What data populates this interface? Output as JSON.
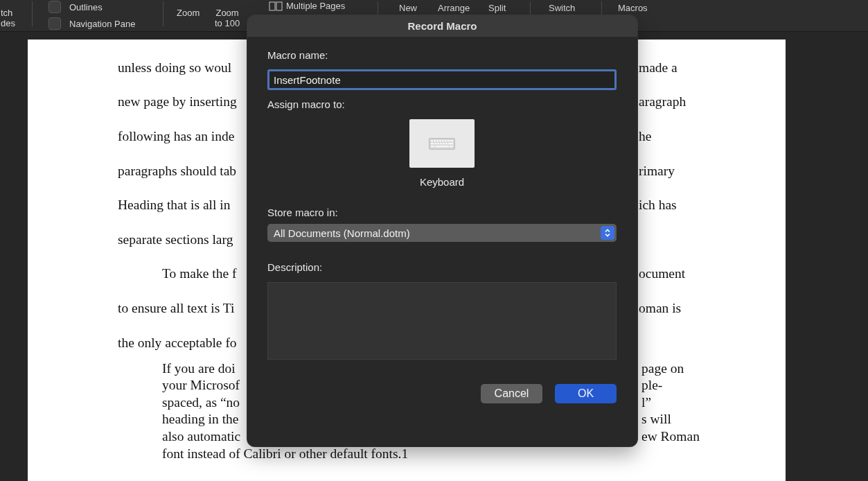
{
  "toolbar": {
    "items": [
      {
        "kind": "label",
        "lines": [
          "tch",
          "des"
        ]
      },
      {
        "kind": "divider"
      },
      {
        "kind": "checks",
        "boxes": [
          {
            "label": "Outlines",
            "checked": false
          },
          {
            "label": "Navigation Pane",
            "checked": false
          }
        ]
      },
      {
        "kind": "divider"
      },
      {
        "kind": "label",
        "lines": [
          "Zoom"
        ]
      },
      {
        "kind": "label",
        "lines": [
          "Zoom",
          "to 100"
        ]
      },
      {
        "kind": "pages",
        "lines": [
          "Multiple Pages"
        ]
      },
      {
        "kind": "divider"
      },
      {
        "kind": "label",
        "lines": [
          "New"
        ]
      },
      {
        "kind": "label",
        "lines": [
          "Arrange"
        ]
      },
      {
        "kind": "label",
        "lines": [
          "Split"
        ]
      },
      {
        "kind": "divider"
      },
      {
        "kind": "label",
        "lines": [
          "Switch"
        ]
      },
      {
        "kind": "divider"
      },
      {
        "kind": "label",
        "lines": [
          "Macros"
        ]
      }
    ]
  },
  "document": {
    "lines": [
      {
        "kind": "double",
        "indent": false,
        "left": "unless doing so woul",
        "right": "made a"
      },
      {
        "kind": "double",
        "indent": false,
        "left": "new page by inserting",
        "right": "aragraph"
      },
      {
        "kind": "double",
        "indent": false,
        "left": "following has an inde",
        "right": "he"
      },
      {
        "kind": "double",
        "indent": false,
        "left": "paragraphs should tab",
        "right": "rimary"
      },
      {
        "kind": "double",
        "indent": false,
        "left": "Heading that is all in",
        "right": "ich has"
      },
      {
        "kind": "double",
        "indent": false,
        "left": "separate sections larg"
      },
      {
        "kind": "double",
        "indent": true,
        "left": "To make the f",
        "right": "ocument"
      },
      {
        "kind": "double",
        "indent": false,
        "left": "to ensure all text is Ti",
        "right": "oman is"
      },
      {
        "kind": "double",
        "indent": false,
        "left": "the only acceptable fo"
      },
      {
        "kind": "single",
        "left": "If you are doi",
        "right": "page on"
      },
      {
        "kind": "single",
        "left": "your Microsof",
        "right": "ple-"
      },
      {
        "kind": "single",
        "left": "spaced, as “no",
        "right": "l”"
      },
      {
        "kind": "single",
        "left": "heading in the",
        "right": "s will"
      },
      {
        "kind": "single",
        "left": "also automatic",
        "right": "ew Roman"
      },
      {
        "kind": "single",
        "left": "font instead of Calibri or other default fonts.1"
      }
    ]
  },
  "dialog": {
    "title": "Record Macro",
    "name_label": "Macro name:",
    "name_value": "InsertFootnote",
    "assign_label": "Assign macro to:",
    "assign_button": "Keyboard",
    "store_label": "Store macro in:",
    "store_value": "All Documents (Normal.dotm)",
    "description_label": "Description:",
    "buttons": [
      {
        "label": "Cancel",
        "default": false
      },
      {
        "label": "OK",
        "default": true
      }
    ]
  }
}
